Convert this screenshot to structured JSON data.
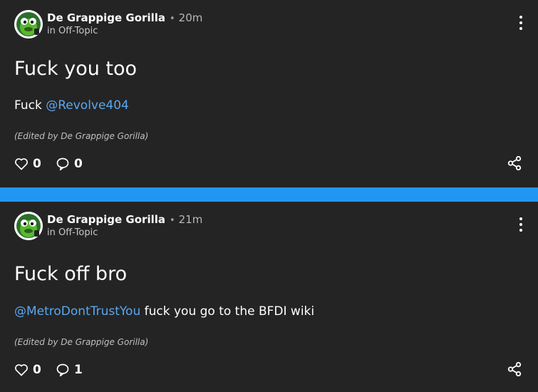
{
  "posts": [
    {
      "author": "De Grappige Gorilla",
      "separator": "•",
      "time": "20m",
      "community": "in Off-Topic",
      "title": "Fuck you too",
      "body_prefix": "Fuck ",
      "mention": "@Revolve404",
      "body_suffix": "",
      "edited": "(Edited by De Grappige Gorilla)",
      "likes": "0",
      "comments": "0"
    },
    {
      "author": "De Grappige Gorilla",
      "separator": "•",
      "time": "21m",
      "community": "in Off-Topic",
      "title": "Fuck off bro",
      "body_prefix": "",
      "mention": "@MetroDontTrustYou",
      "body_suffix": " fuck you go to the BFDI wiki",
      "edited": "(Edited by De Grappige Gorilla)",
      "likes": "0",
      "comments": "1"
    }
  ],
  "icons": {
    "like": "heart-icon",
    "comment": "speech-bubble-icon",
    "share": "share-icon",
    "menu": "more-vertical-icon"
  },
  "colors": {
    "background": "#242424",
    "divider": "#2196f3",
    "mention": "#5aa7f0"
  }
}
